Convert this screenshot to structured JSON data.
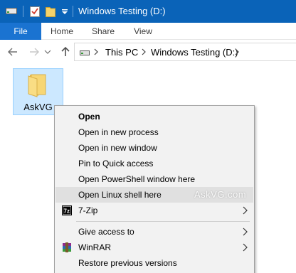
{
  "window": {
    "title": "Windows Testing (D:)",
    "accent_color": "#0a63b8"
  },
  "quick_access": {
    "icons": [
      "drive-icon",
      "properties-icon",
      "new-folder-icon",
      "customize-dropdown-icon"
    ]
  },
  "ribbon": {
    "tabs": [
      {
        "label": "File",
        "active": true
      },
      {
        "label": "Home"
      },
      {
        "label": "Share"
      },
      {
        "label": "View"
      }
    ]
  },
  "address_bar": {
    "breadcrumbs": [
      "This PC",
      "Windows Testing (D:)"
    ]
  },
  "content": {
    "items": [
      {
        "name": "AskVG",
        "type": "folder",
        "selected": true
      }
    ]
  },
  "context_menu": {
    "items": [
      {
        "label": "Open",
        "bold": true
      },
      {
        "label": "Open in new process"
      },
      {
        "label": "Open in new window"
      },
      {
        "label": "Pin to Quick access"
      },
      {
        "label": "Open PowerShell window here"
      },
      {
        "label": "Open Linux shell here",
        "highlighted": true
      },
      {
        "label": "7-Zip",
        "icon": "7zip-icon",
        "submenu": true
      },
      {
        "label": "Give access to",
        "submenu": true
      },
      {
        "label": "WinRAR",
        "icon": "winrar-icon",
        "submenu": true
      },
      {
        "label": "Restore previous versions"
      }
    ],
    "watermark": "AskVG.com"
  }
}
